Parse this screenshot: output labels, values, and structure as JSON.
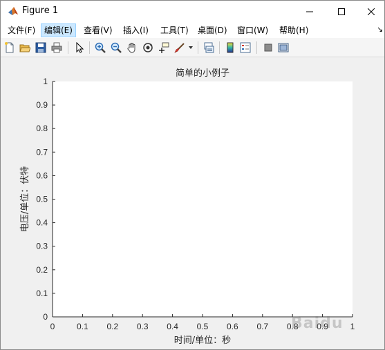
{
  "window": {
    "title": "Figure 1"
  },
  "menu": {
    "items": [
      {
        "label": "文件(F)"
      },
      {
        "label": "编辑(E)"
      },
      {
        "label": "查看(V)"
      },
      {
        "label": "插入(I)"
      },
      {
        "label": "工具(T)"
      },
      {
        "label": "桌面(D)"
      },
      {
        "label": "窗口(W)"
      },
      {
        "label": "帮助(H)"
      }
    ],
    "active_index": 1
  },
  "toolbar": {
    "icons": [
      "new-figure-icon",
      "open-icon",
      "save-icon",
      "print-icon",
      "pointer-icon",
      "zoom-in-icon",
      "zoom-out-icon",
      "pan-icon",
      "rotate-3d-icon",
      "data-cursor-icon",
      "brush-icon",
      "link-plot-icon",
      "colorbar-icon",
      "legend-icon",
      "hide-plot-tools-icon",
      "show-plot-tools-icon"
    ]
  },
  "chart_data": {
    "type": "line",
    "title": "简单的小例子",
    "xlabel": "时间/单位：秒",
    "ylabel": "电压/单位：伏特",
    "xlim": [
      0,
      1
    ],
    "ylim": [
      0,
      1
    ],
    "xticks": [
      "0",
      "0.1",
      "0.2",
      "0.3",
      "0.4",
      "0.5",
      "0.6",
      "0.7",
      "0.8",
      "0.9",
      "1"
    ],
    "yticks": [
      "0",
      "0.1",
      "0.2",
      "0.3",
      "0.4",
      "0.5",
      "0.6",
      "0.7",
      "0.8",
      "0.9",
      "1"
    ],
    "series": [],
    "grid": false,
    "axes_background": "#ffffff",
    "figure_background": "#f0f0f0"
  },
  "watermark": {
    "text": "Baidu"
  }
}
